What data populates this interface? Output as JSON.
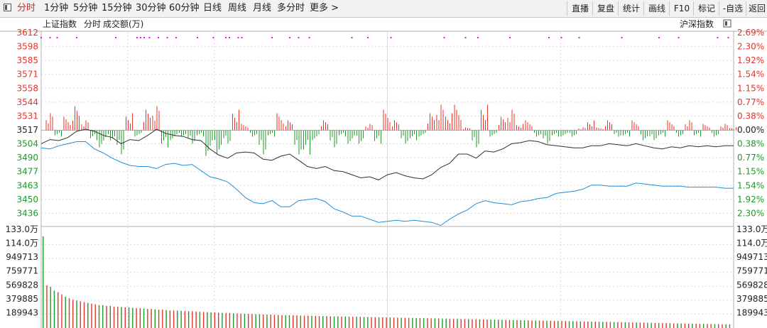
{
  "toolbar": {
    "tabs": [
      "分时",
      "1分钟",
      "5分钟",
      "15分钟",
      "30分钟",
      "60分钟",
      "日线",
      "周线",
      "月线",
      "多分时",
      "更多"
    ],
    "more_arrow": ">",
    "right_buttons": [
      "直播",
      "复盘",
      "统计",
      "画线",
      "F10",
      "标记",
      "-自选",
      "返回"
    ]
  },
  "chart_header": {
    "index_name": "上证指数",
    "period": "分时",
    "metric": "成交额(万)",
    "compare_index": "沪深指数"
  },
  "colors": {
    "up": "#e8332a",
    "down": "#1e9a28",
    "index_line": "#303030",
    "compare_line": "#1e8fdd",
    "marker": "#ff00ff",
    "grid": "#d8d8d8",
    "axis": "#b0b0b0"
  },
  "chart_data": [
    {
      "type": "line",
      "title": "上证指数 分时",
      "y_left_labels": [
        "3612",
        "3598",
        "3585",
        "3571",
        "3558",
        "3544",
        "3531",
        "3517",
        "3504",
        "3490",
        "3477",
        "3463",
        "3450",
        "3436"
      ],
      "y_right_labels": [
        "2.69%",
        "2.30%",
        "1.92%",
        "1.54%",
        "1.15%",
        "0.77%",
        "0.38%",
        "0.00%",
        "0.38%",
        "0.77%",
        "1.15%",
        "1.54%",
        "1.92%",
        "2.30%"
      ],
      "ylim": [
        3424,
        3612
      ],
      "baseline": 3517,
      "series": [
        {
          "name": "上证指数",
          "points": [
            [
              0,
              3504
            ],
            [
              5,
              3508
            ],
            [
              10,
              3507
            ],
            [
              15,
              3510
            ],
            [
              20,
              3516
            ],
            [
              25,
              3518
            ],
            [
              30,
              3516
            ],
            [
              35,
              3512
            ],
            [
              40,
              3510
            ],
            [
              45,
              3504
            ],
            [
              50,
              3508
            ],
            [
              55,
              3507
            ],
            [
              60,
              3512
            ],
            [
              65,
              3518
            ],
            [
              70,
              3514
            ],
            [
              75,
              3512
            ],
            [
              80,
              3511
            ],
            [
              85,
              3508
            ],
            [
              90,
              3507
            ],
            [
              95,
              3499
            ],
            [
              100,
              3493
            ],
            [
              105,
              3490
            ],
            [
              110,
              3495
            ],
            [
              115,
              3496
            ],
            [
              120,
              3495
            ],
            [
              125,
              3489
            ],
            [
              130,
              3488
            ],
            [
              135,
              3492
            ],
            [
              140,
              3494
            ],
            [
              145,
              3488
            ],
            [
              150,
              3482
            ],
            [
              155,
              3480
            ],
            [
              160,
              3482
            ],
            [
              165,
              3478
            ],
            [
              170,
              3477
            ],
            [
              175,
              3474
            ],
            [
              180,
              3471
            ],
            [
              185,
              3472
            ],
            [
              190,
              3469
            ],
            [
              195,
              3474
            ],
            [
              200,
              3476
            ],
            [
              205,
              3473
            ],
            [
              210,
              3471
            ],
            [
              215,
              3470
            ],
            [
              220,
              3474
            ],
            [
              225,
              3481
            ],
            [
              230,
              3485
            ],
            [
              235,
              3494
            ],
            [
              240,
              3494
            ],
            [
              245,
              3490
            ],
            [
              250,
              3497
            ],
            [
              255,
              3496
            ],
            [
              260,
              3499
            ],
            [
              265,
              3504
            ],
            [
              270,
              3505
            ],
            [
              275,
              3507
            ],
            [
              280,
              3506
            ],
            [
              285,
              3503
            ],
            [
              290,
              3502
            ],
            [
              295,
              3501
            ],
            [
              300,
              3500
            ],
            [
              305,
              3500
            ],
            [
              310,
              3502
            ],
            [
              315,
              3502
            ],
            [
              320,
              3504
            ],
            [
              325,
              3503
            ],
            [
              330,
              3502
            ],
            [
              335,
              3504
            ],
            [
              340,
              3502
            ],
            [
              345,
              3500
            ],
            [
              350,
              3499
            ],
            [
              355,
              3501
            ],
            [
              360,
              3500
            ],
            [
              365,
              3502
            ],
            [
              370,
              3501
            ],
            [
              375,
              3502
            ],
            [
              380,
              3501
            ],
            [
              385,
              3502
            ],
            [
              390,
              3502
            ]
          ]
        },
        {
          "name": "沪深指数",
          "points": [
            [
              0,
              3500
            ],
            [
              5,
              3499
            ],
            [
              10,
              3502
            ],
            [
              15,
              3504
            ],
            [
              20,
              3506
            ],
            [
              25,
              3506
            ],
            [
              30,
              3499
            ],
            [
              35,
              3495
            ],
            [
              40,
              3490
            ],
            [
              45,
              3486
            ],
            [
              50,
              3483
            ],
            [
              55,
              3482
            ],
            [
              60,
              3482
            ],
            [
              65,
              3480
            ],
            [
              70,
              3484
            ],
            [
              75,
              3485
            ],
            [
              80,
              3483
            ],
            [
              85,
              3484
            ],
            [
              90,
              3478
            ],
            [
              95,
              3472
            ],
            [
              100,
              3470
            ],
            [
              105,
              3467
            ],
            [
              110,
              3460
            ],
            [
              115,
              3452
            ],
            [
              120,
              3447
            ],
            [
              125,
              3446
            ],
            [
              130,
              3449
            ],
            [
              135,
              3443
            ],
            [
              140,
              3443
            ],
            [
              145,
              3449
            ],
            [
              150,
              3450
            ],
            [
              155,
              3451
            ],
            [
              160,
              3448
            ],
            [
              165,
              3441
            ],
            [
              170,
              3438
            ],
            [
              175,
              3434
            ],
            [
              180,
              3434
            ],
            [
              185,
              3431
            ],
            [
              190,
              3428
            ],
            [
              195,
              3429
            ],
            [
              200,
              3430
            ],
            [
              205,
              3429
            ],
            [
              210,
              3430
            ],
            [
              215,
              3429
            ],
            [
              220,
              3428
            ],
            [
              225,
              3425
            ],
            [
              230,
              3431
            ],
            [
              235,
              3436
            ],
            [
              240,
              3440
            ],
            [
              245,
              3446
            ],
            [
              250,
              3449
            ],
            [
              255,
              3447
            ],
            [
              260,
              3446
            ],
            [
              265,
              3445
            ],
            [
              270,
              3448
            ],
            [
              275,
              3449
            ],
            [
              280,
              3451
            ],
            [
              285,
              3452
            ],
            [
              290,
              3456
            ],
            [
              295,
              3457
            ],
            [
              300,
              3458
            ],
            [
              305,
              3460
            ],
            [
              310,
              3464
            ],
            [
              315,
              3464
            ],
            [
              320,
              3463
            ],
            [
              325,
              3463
            ],
            [
              330,
              3463
            ],
            [
              335,
              3466
            ],
            [
              340,
              3465
            ],
            [
              345,
              3464
            ],
            [
              350,
              3463
            ],
            [
              355,
              3463
            ],
            [
              360,
              3463
            ],
            [
              365,
              3462
            ],
            [
              370,
              3462
            ],
            [
              375,
              3462
            ],
            [
              380,
              3462
            ],
            [
              385,
              3461
            ],
            [
              390,
              3461
            ]
          ]
        }
      ],
      "markers": [
        0,
        5,
        9,
        20,
        42,
        54,
        56,
        58,
        61,
        66,
        71,
        76,
        88,
        97,
        104,
        106,
        111,
        113,
        130,
        140,
        145,
        151,
        175,
        184,
        197,
        227,
        239,
        246,
        264,
        286,
        293,
        303,
        327,
        348,
        359,
        381,
        387
      ]
    },
    {
      "type": "bar",
      "title": "成交额",
      "y_left_labels": [
        "133.0万",
        "114.0万",
        "949713",
        "759771",
        "569828",
        "379885",
        "189943"
      ],
      "y_right_labels": [
        "133.0万",
        "114.0万",
        "949713",
        "759771",
        "569828",
        "379885",
        "189943"
      ],
      "ylim": [
        0,
        1330000
      ],
      "values": [
        1200000,
        560000,
        540000,
        490000,
        470000,
        440000,
        410000,
        390000,
        370000,
        360000,
        350000,
        340000,
        330000,
        320000,
        310000,
        300000,
        300000,
        290000,
        290000,
        280000,
        280000,
        275000,
        270000,
        270000,
        265000,
        260000,
        260000,
        255000,
        250000,
        250000,
        245000,
        240000,
        240000,
        235000,
        230000,
        230000,
        228000,
        225000,
        222000,
        220000,
        218000,
        215000,
        212000,
        210000,
        208000,
        205000,
        203000,
        201000,
        199000,
        197000,
        195000,
        193000,
        191000,
        189000,
        187000,
        185000,
        183000,
        181000,
        180000,
        178000,
        176000,
        175000,
        173000,
        172000,
        170000,
        169000,
        167000,
        166000,
        165000,
        163000,
        162000,
        161000,
        160000,
        158000,
        157000,
        156000,
        155000,
        154000,
        153000,
        152000,
        151000,
        150000,
        149000,
        148000,
        147000,
        146000,
        145000,
        144000,
        143000,
        142000,
        141000,
        140000,
        139000,
        138000,
        137000,
        136000,
        135000,
        134000,
        133000,
        132000,
        131000,
        130000,
        129000,
        128000,
        127000,
        126000,
        125000,
        124000,
        123000,
        122000,
        121000,
        120000,
        119000,
        118000,
        117000,
        116000,
        115000,
        114000,
        113000,
        112000,
        111000,
        110000,
        109000,
        108000,
        107000,
        106000,
        105000,
        104000,
        103000,
        102000,
        101000,
        100000,
        99000,
        98000,
        97000,
        96000,
        95000,
        94000,
        93000,
        92000,
        91000,
        90000,
        89000,
        88000,
        87000,
        86000,
        85000,
        84000,
        83000,
        82000,
        81000,
        80000,
        79000,
        78000,
        77000,
        76000,
        75000,
        74000,
        73000,
        72000,
        71000,
        70000,
        69000,
        68000,
        67000,
        66000,
        65000,
        64000,
        63000,
        62000,
        61000,
        60000,
        59000,
        58000,
        57000,
        56000,
        55000,
        54000,
        53000,
        52000,
        51000,
        50000,
        49000,
        48000,
        47000,
        46000,
        45000,
        44000,
        43000,
        42000,
        41000,
        40000,
        39000,
        38000,
        37000,
        36000,
        35000,
        34000,
        33000,
        32000,
        31000,
        30000,
        29000,
        28000,
        27000,
        26000,
        25000,
        24000,
        23000,
        22000,
        21000,
        20000
      ]
    }
  ]
}
